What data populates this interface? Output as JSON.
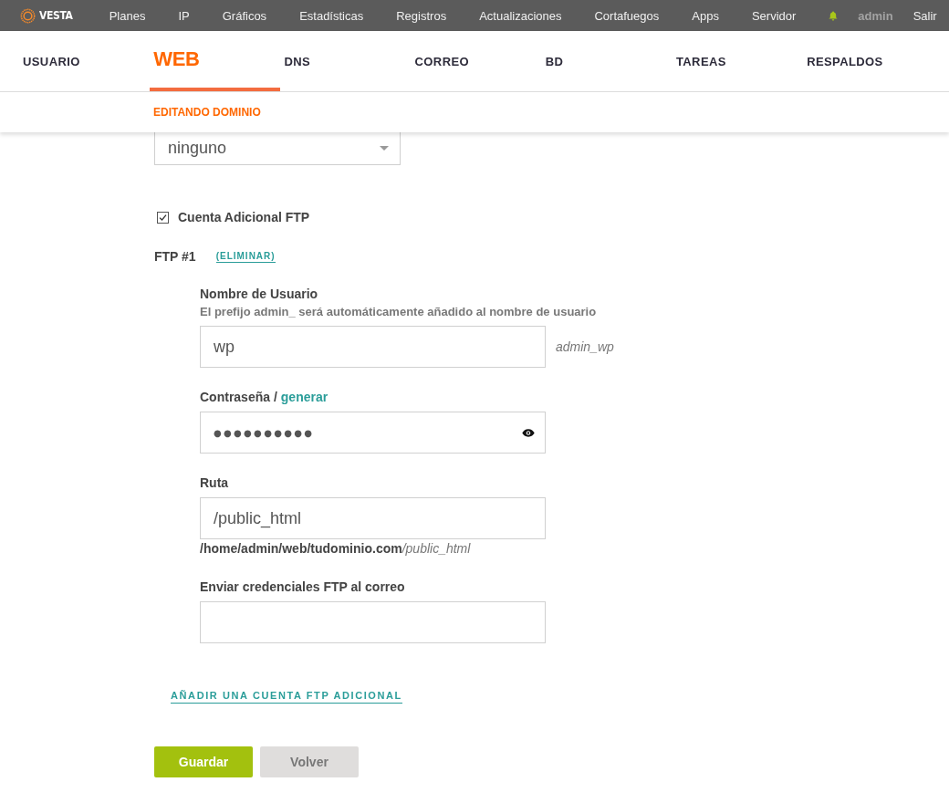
{
  "top_bar": {
    "logo": "VESTA",
    "menu": [
      {
        "label": "Planes"
      },
      {
        "label": "IP"
      },
      {
        "label": "Gráficos"
      },
      {
        "label": "Estadísticas"
      },
      {
        "label": "Registros"
      },
      {
        "label": "Actualizaciones"
      },
      {
        "label": "Cortafuegos"
      },
      {
        "label": "Apps"
      },
      {
        "label": "Servidor"
      }
    ],
    "user": "admin",
    "logout": "Salir"
  },
  "tabs": [
    {
      "label": "USUARIO",
      "selected": false
    },
    {
      "label": "WEB",
      "selected": true
    },
    {
      "label": "DNS",
      "selected": false
    },
    {
      "label": "CORREO",
      "selected": false
    },
    {
      "label": "BD",
      "selected": false
    },
    {
      "label": "TAREAS",
      "selected": false
    },
    {
      "label": "RESPALDOS",
      "selected": false
    }
  ],
  "subtitle": "EDITANDO DOMINIO",
  "form": {
    "select": {
      "value": "ninguno"
    },
    "ftp_option": {
      "label": "Cuenta Adicional FTP",
      "checked": true
    },
    "ftp_accounts": [
      {
        "title": "FTP #1",
        "remove_link": "(ELIMINAR)",
        "username": {
          "label": "Nombre de Usuario",
          "hint": "El prefijo admin_ será automáticamente añadido al nombre de usuario",
          "value": "wp",
          "preview": "admin_wp"
        },
        "password": {
          "label": "Contraseña /",
          "generate_link": "generar",
          "value": "●●●●●●●●●●"
        },
        "path": {
          "label": "Ruta",
          "value": "/public_html",
          "full_path": {
            "base": "/home/admin/web/tudominio.com",
            "suffix": "/public_html"
          }
        },
        "email": {
          "label": "Enviar credenciales FTP al correo"
        }
      }
    ],
    "add_account_link": "AÑADIR UNA CUENTA FTP ADICIONAL",
    "buttons": [
      {
        "label": "Guardar",
        "kind": "primary"
      },
      {
        "label": "Volver",
        "kind": "secondary"
      }
    ]
  }
}
